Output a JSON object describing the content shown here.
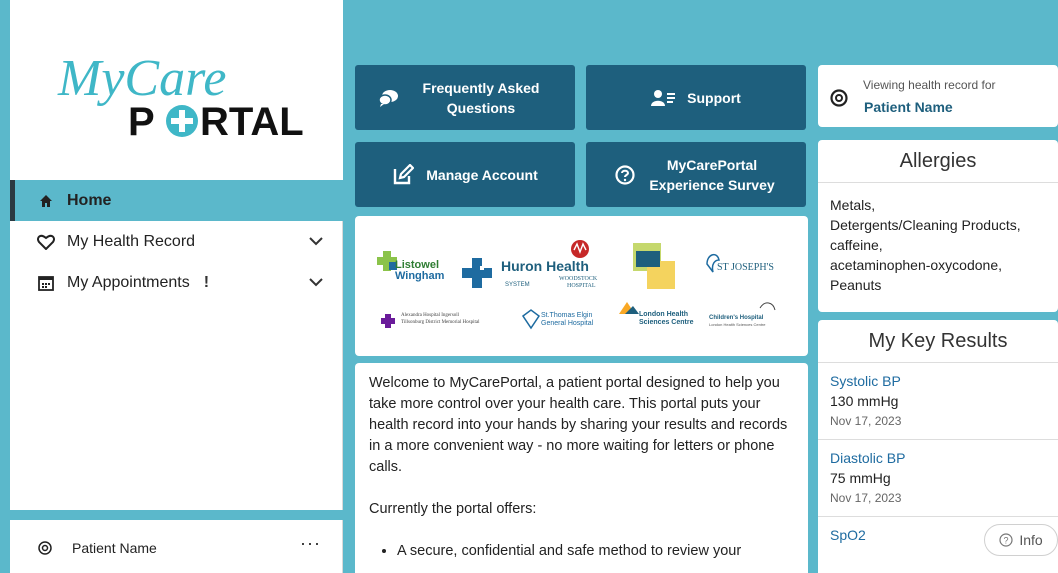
{
  "sidebar": {
    "logo": {
      "line1": "MyCare",
      "line2_part1": "P",
      "line2_part2": "RTAL"
    },
    "nav": [
      {
        "label": "Home",
        "icon": "home-icon",
        "active": true
      },
      {
        "label": "My Health Record",
        "icon": "heart-icon"
      },
      {
        "label": "My Appointments",
        "icon": "calendar-icon",
        "badge": "!"
      }
    ],
    "user": {
      "name": "Patient Name",
      "menu": "···"
    }
  },
  "tiles": {
    "faq": "Frequently Asked Questions",
    "support": "Support",
    "manage": "Manage Account",
    "survey": "MyCarePortal Experience Survey"
  },
  "logos": {
    "listowel": "Listowel Wingham",
    "huron": "Huron Health",
    "huron_sub": "SYSTEM",
    "woodstock": "WOODSTOCK HOSPITAL",
    "stjosephs": "ST JOSEPH'S",
    "alexandra": "Alexandra Hospital Ingersoll Tillsonburg District Memorial Hospital",
    "stthomas": "St.Thomas Elgin General Hospital",
    "lhsc": "London Health Sciences Centre",
    "childrens": "Children's Hospital"
  },
  "welcome": {
    "para1": "Welcome to MyCarePortal, a patient portal designed to help you take more control over your health care. This portal puts your health record into your hands by sharing your results and records in a more convenient way - no more waiting for letters or phone calls.",
    "para2": "Currently the portal offers:",
    "bullet1": "A secure, confidential and safe method to review your"
  },
  "viewing": {
    "label": "Viewing health record for",
    "name": "Patient Name"
  },
  "allergies": {
    "title": "Allergies",
    "items": [
      "Metals,",
      "Detergents/Cleaning Products,",
      "caffeine,",
      "acetaminophen-oxycodone,",
      "Peanuts"
    ]
  },
  "results": {
    "title": "My Key Results",
    "items": [
      {
        "name": "Systolic BP",
        "value": "130 mmHg",
        "date": "Nov 17, 2023"
      },
      {
        "name": "Diastolic BP",
        "value": "75 mmHg",
        "date": "Nov 17, 2023"
      },
      {
        "name": "SpO2",
        "value": "",
        "date": ""
      }
    ]
  },
  "info": {
    "label": "Info"
  },
  "colors": {
    "teal": "#5bb8cb",
    "navy": "#1e5f7d",
    "link": "#1e6ba0"
  }
}
